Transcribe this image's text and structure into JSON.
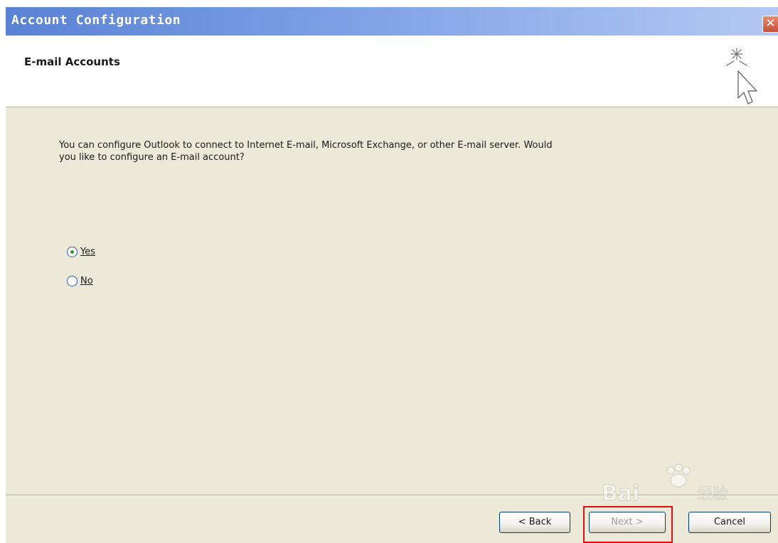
{
  "window": {
    "title": "Account Configuration",
    "close_glyph": "✕",
    "title_gradient": [
      "#5a82d4",
      "#b3c9f2"
    ]
  },
  "header": {
    "heading": "E-mail Accounts",
    "icon": "wizard-sparkle-cursor-icon"
  },
  "body": {
    "description": "You can configure Outlook to connect to Internet E-mail, Microsoft Exchange, or other E-mail server. Would you like to configure an E-mail account?"
  },
  "options": [
    {
      "label": "Yes",
      "selected": true
    },
    {
      "label": "No",
      "selected": false
    }
  ],
  "buttons": {
    "back": "< Back",
    "next": "Next >",
    "cancel": "Cancel"
  },
  "watermark": {
    "text": "Baidu 经验"
  },
  "colors": {
    "dialog_bg": "#ece9d8",
    "highlight": "#e01010",
    "radio_dot": "#2b9e3a"
  }
}
